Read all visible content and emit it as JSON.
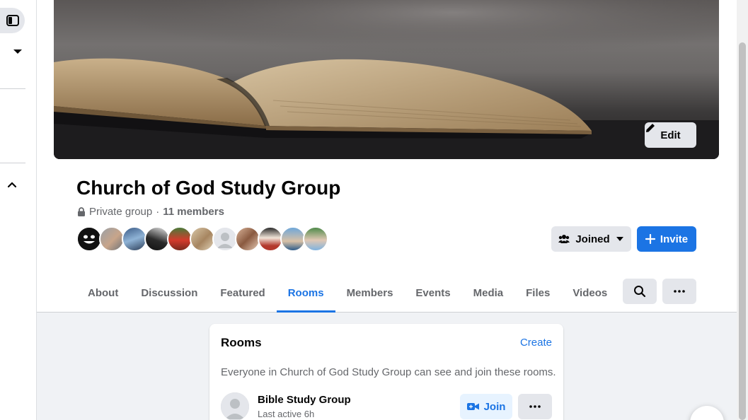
{
  "cover": {
    "edit_label": "Edit"
  },
  "group": {
    "title": "Church of God Study Group",
    "privacy": "Private group",
    "separator": "·",
    "members": "11 members"
  },
  "actions": {
    "joined_label": "Joined",
    "invite_label": "Invite"
  },
  "tabs": [
    {
      "label": "About",
      "active": false
    },
    {
      "label": "Discussion",
      "active": false
    },
    {
      "label": "Featured",
      "active": false
    },
    {
      "label": "Rooms",
      "active": true
    },
    {
      "label": "Members",
      "active": false
    },
    {
      "label": "Events",
      "active": false
    },
    {
      "label": "Media",
      "active": false
    },
    {
      "label": "Files",
      "active": false
    },
    {
      "label": "Videos",
      "active": false
    }
  ],
  "rooms": {
    "title": "Rooms",
    "create_label": "Create",
    "description": "Everyone in Church of God Study Group can see and join these rooms.",
    "items": [
      {
        "name": "Bible Study Group",
        "last_active": "Last active 6h",
        "join_label": "Join"
      }
    ]
  },
  "colors": {
    "accent": "#1b74e4",
    "secondary_bg": "#e4e6eb",
    "page_bg": "#f0f2f5"
  },
  "icons": [
    "sidebar-toggle-icon",
    "caret-down-icon",
    "chevron-up-icon",
    "pencil-icon",
    "lock-icon",
    "people-icon",
    "plus-icon",
    "search-icon",
    "more-icon",
    "video-icon"
  ]
}
